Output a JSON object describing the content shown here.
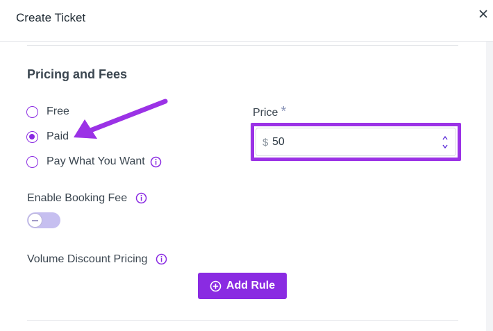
{
  "header": {
    "title": "Create Ticket",
    "close_icon": "close-icon"
  },
  "pricing": {
    "title": "Pricing and Fees",
    "options": [
      {
        "label": "Free",
        "checked": false
      },
      {
        "label": "Paid",
        "checked": true
      },
      {
        "label": "Pay What You Want",
        "checked": false,
        "has_info": true
      }
    ]
  },
  "price": {
    "label": "Price",
    "required_mark": "*",
    "currency": "$",
    "value": "50"
  },
  "booking_fee": {
    "label": "Enable Booking Fee",
    "enabled": false
  },
  "volume_discount": {
    "label": "Volume Discount Pricing",
    "button_label": "Add Rule",
    "button_icon": "plus-circle-icon"
  },
  "colors": {
    "accent": "#8a2be2",
    "highlight": "#9b32e6",
    "text": "#3b4650"
  }
}
